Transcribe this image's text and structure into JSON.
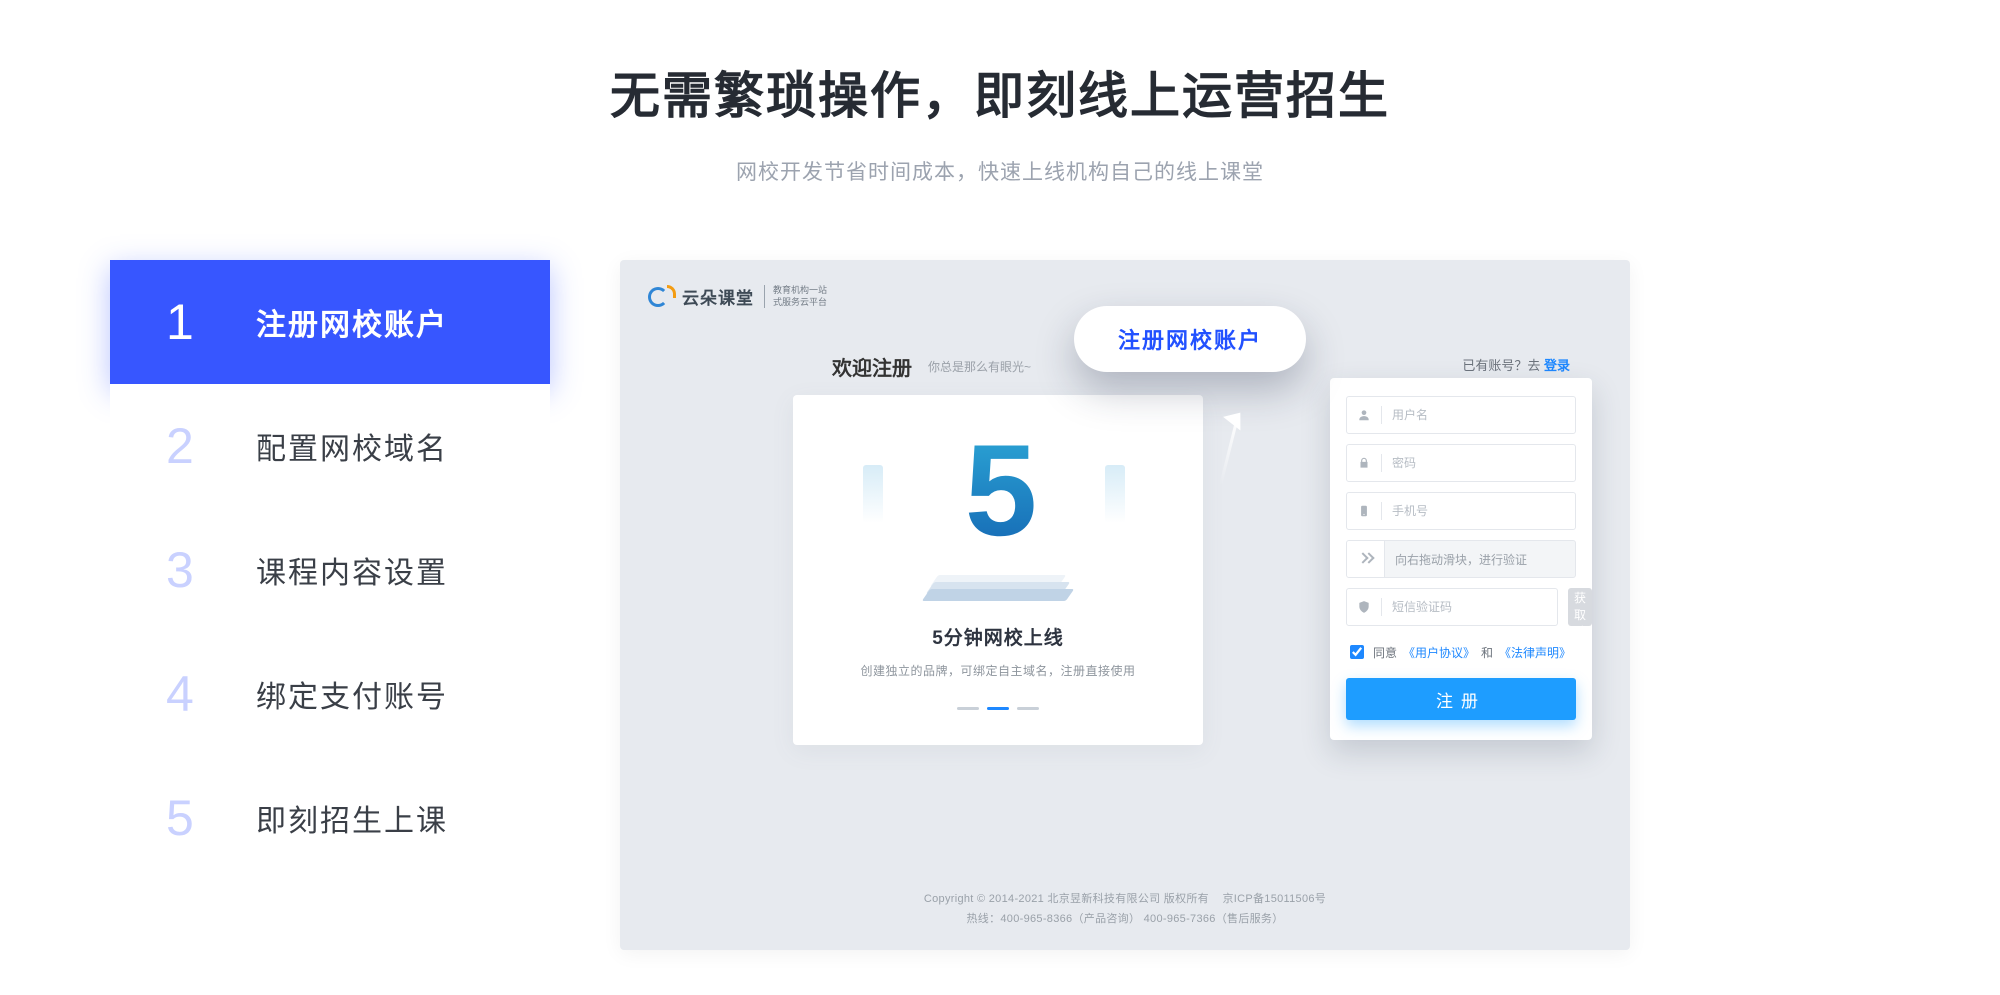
{
  "headline": {
    "title": "无需繁琐操作，即刻线上运营招生",
    "subtitle": "网校开发节省时间成本，快速上线机构自己的线上课堂"
  },
  "steps": [
    {
      "num": "1",
      "label": "注册网校账户",
      "active": true
    },
    {
      "num": "2",
      "label": "配置网校域名",
      "active": false
    },
    {
      "num": "3",
      "label": "课程内容设置",
      "active": false
    },
    {
      "num": "4",
      "label": "绑定支付账号",
      "active": false
    },
    {
      "num": "5",
      "label": "即刻招生上课",
      "active": false
    }
  ],
  "preview": {
    "logo_text": "云朵课堂",
    "logo_sub_line1": "教育机构一站",
    "logo_sub_line2": "式服务云平台",
    "welcome": "欢迎注册",
    "welcome_sub": "你总是那么有眼光~",
    "have_account_prefix": "已有账号？去",
    "have_account_link": "登录",
    "promo": {
      "glyph": "5",
      "title": "5分钟网校上线",
      "desc": "创建独立的品牌，可绑定自主域名，注册直接使用"
    },
    "form": {
      "user_ph": "用户名",
      "pass_ph": "密码",
      "phone_ph": "手机号",
      "slider_hint": "向右拖动滑块，进行验证",
      "sms_ph": "短信验证码",
      "get_code": "获取验证码",
      "agree_prefix": "同意",
      "agree_user": "《用户协议》",
      "agree_and": "和",
      "agree_law": "《法律声明》",
      "submit": "注册"
    },
    "bubble": "注册网校账户",
    "footer": {
      "line1_a": "Copyright © 2014-2021 北京昱新科技有限公司  版权所有",
      "line1_b": "京ICP备15011506号",
      "line2": "热线：400-965-8366（产品咨询）  400-965-7366（售后服务）"
    }
  }
}
